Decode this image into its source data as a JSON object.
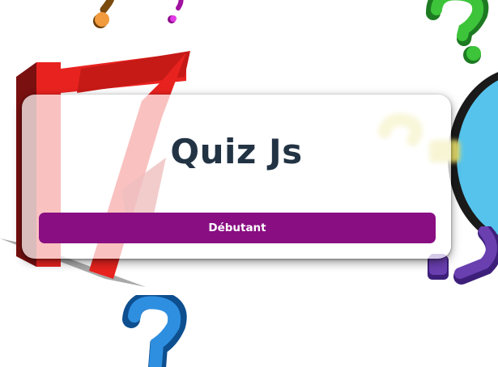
{
  "page": {
    "title": "Quiz Js"
  },
  "levels": [
    {
      "label": "Débutant"
    }
  ],
  "colors": {
    "title_text": "#223344",
    "button_bg": "#880e82",
    "button_text": "#ffffff",
    "card_bg": "#ffffff"
  },
  "decorations": [
    "orange-question-mark-icon",
    "magenta-question-mark-icon",
    "green-question-mark-icon",
    "blue-question-mark-icon",
    "purple-question-mark-icon",
    "yellow-question-mark-icon",
    "red-seven-shape",
    "cyan-ring-shape"
  ]
}
